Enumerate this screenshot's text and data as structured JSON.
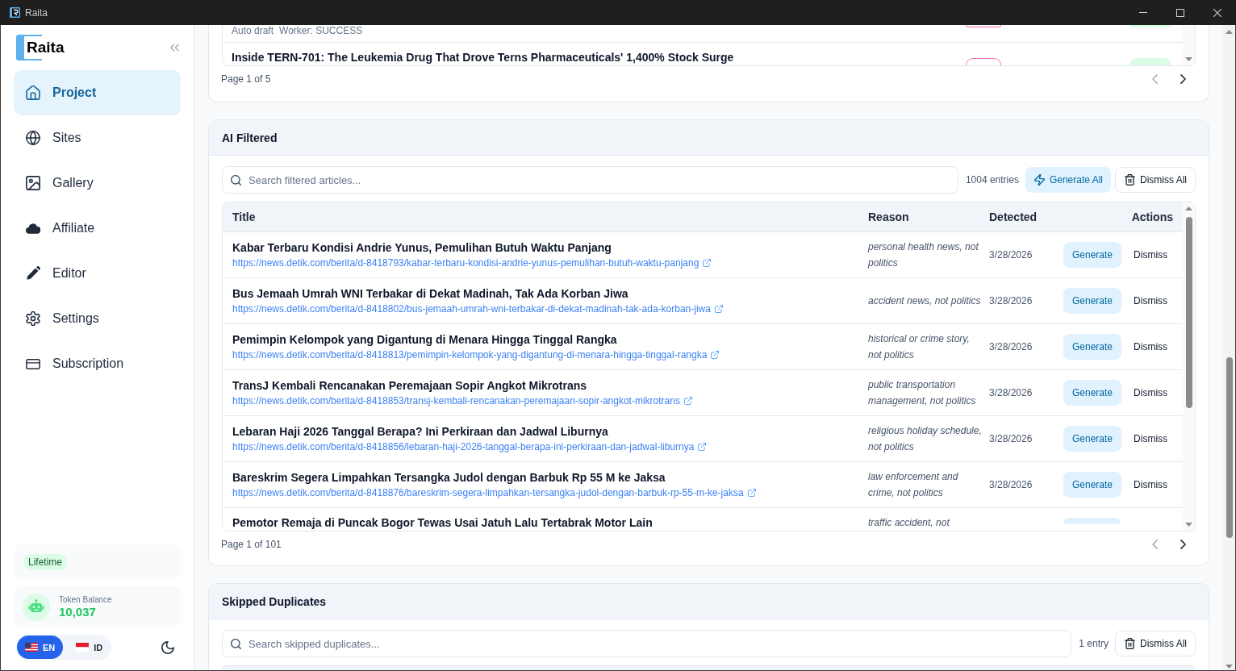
{
  "window": {
    "title": "Raita"
  },
  "sidebar": {
    "logo": "Raita",
    "items": [
      {
        "label": "Project",
        "selected": true
      },
      {
        "label": "Sites",
        "selected": false
      },
      {
        "label": "Gallery",
        "selected": false
      },
      {
        "label": "Affiliate",
        "selected": false
      },
      {
        "label": "Editor",
        "selected": false
      },
      {
        "label": "Settings",
        "selected": false
      },
      {
        "label": "Subscription",
        "selected": false
      }
    ],
    "plan_badge": "Lifetime",
    "token_balance": {
      "label": "Token Balance",
      "value": "10,037"
    },
    "languages": [
      {
        "code": "EN",
        "selected": true
      },
      {
        "code": "ID",
        "selected": false
      }
    ]
  },
  "articles_panel": {
    "rows": [
      {
        "meta": [
          "Auto draft",
          "Worker: SUCCESS"
        ],
        "badges": [
          {
            "kind": "outline",
            "color": "#f472b6"
          },
          {
            "kind": "soft",
            "color": "#dcfce7"
          }
        ]
      },
      {
        "title": "Inside TERN-701: The Leukemia Drug That Drove Terns Pharmaceuticals' 1,400% Stock Surge",
        "badges": [
          {
            "kind": "outline",
            "color": "#f472b6"
          },
          {
            "kind": "soft",
            "color": "#dcfce7"
          }
        ]
      }
    ],
    "pagination": {
      "label": "Page 1 of 5",
      "previous": {
        "disabled": true
      },
      "next": {
        "disabled": false
      }
    }
  },
  "ai_filtered": {
    "title": "AI Filtered",
    "search": {
      "placeholder": "Search filtered articles..."
    },
    "count": "1004 entries",
    "buttons": [
      {
        "label": "Generate All",
        "kind": "primary"
      },
      {
        "label": "Dismiss All",
        "kind": "secondary"
      }
    ],
    "table": {
      "columns": [
        "Title",
        "Reason",
        "Detected",
        "Actions"
      ],
      "rows": [
        {
          "title": "Kabar Terbaru Kondisi Andrie Yunus, Pemulihan Butuh Waktu Panjang",
          "url": "https://news.detik.com/berita/d-8418793/kabar-terbaru-kondisi-andrie-yunus-pemulihan-butuh-waktu-panjang",
          "reason": "personal health news, not politics",
          "detected": "3/28/2026",
          "actions": [
            "Generate",
            "Dismiss"
          ]
        },
        {
          "title": "Bus Jemaah Umrah WNI Terbakar di Dekat Madinah, Tak Ada Korban Jiwa",
          "url": "https://news.detik.com/berita/d-8418802/bus-jemaah-umrah-wni-terbakar-di-dekat-madinah-tak-ada-korban-jiwa",
          "reason": "accident news, not politics",
          "detected": "3/28/2026",
          "actions": [
            "Generate",
            "Dismiss"
          ]
        },
        {
          "title": "Pemimpin Kelompok yang Digantung di Menara Hingga Tinggal Rangka",
          "url": "https://news.detik.com/berita/d-8418813/pemimpin-kelompok-yang-digantung-di-menara-hingga-tinggal-rangka",
          "reason": "historical or crime story, not politics",
          "detected": "3/28/2026",
          "actions": [
            "Generate",
            "Dismiss"
          ]
        },
        {
          "title": "TransJ Kembali Rencanakan Peremajaan Sopir Angkot Mikrotrans",
          "url": "https://news.detik.com/berita/d-8418853/transj-kembali-rencanakan-peremajaan-sopir-angkot-mikrotrans",
          "reason": "public transportation management, not politics",
          "detected": "3/28/2026",
          "actions": [
            "Generate",
            "Dismiss"
          ]
        },
        {
          "title": "Lebaran Haji 2026 Tanggal Berapa? Ini Perkiraan dan Jadwal Liburnya",
          "url": "https://news.detik.com/berita/d-8418856/lebaran-haji-2026-tanggal-berapa-ini-perkiraan-dan-jadwal-liburnya",
          "reason": "religious holiday schedule, not politics",
          "detected": "3/28/2026",
          "actions": [
            "Generate",
            "Dismiss"
          ]
        },
        {
          "title": "Bareskrim Segera Limpahkan Tersangka Judol dengan Barbuk Rp 55 M ke Jaksa",
          "url": "https://news.detik.com/berita/d-8418876/bareskrim-segera-limpahkan-tersangka-judol-dengan-barbuk-rp-55-m-ke-jaksa",
          "reason": "law enforcement and crime, not politics",
          "detected": "3/28/2026",
          "actions": [
            "Generate",
            "Dismiss"
          ]
        },
        {
          "title": "Pemotor Remaja di Puncak Bogor Tewas Usai Jatuh Lalu Tertabrak Motor Lain",
          "reason": "traffic accident, not"
        }
      ]
    },
    "pagination": {
      "label": "Page 1 of 101",
      "previous": {
        "disabled": true
      },
      "next": {
        "disabled": false
      }
    }
  },
  "skipped_duplicates": {
    "title": "Skipped Duplicates",
    "search": {
      "placeholder": "Search skipped duplicates..."
    },
    "count": "1 entry",
    "buttons": [
      {
        "label": "Dismiss All",
        "kind": "secondary"
      }
    ]
  }
}
